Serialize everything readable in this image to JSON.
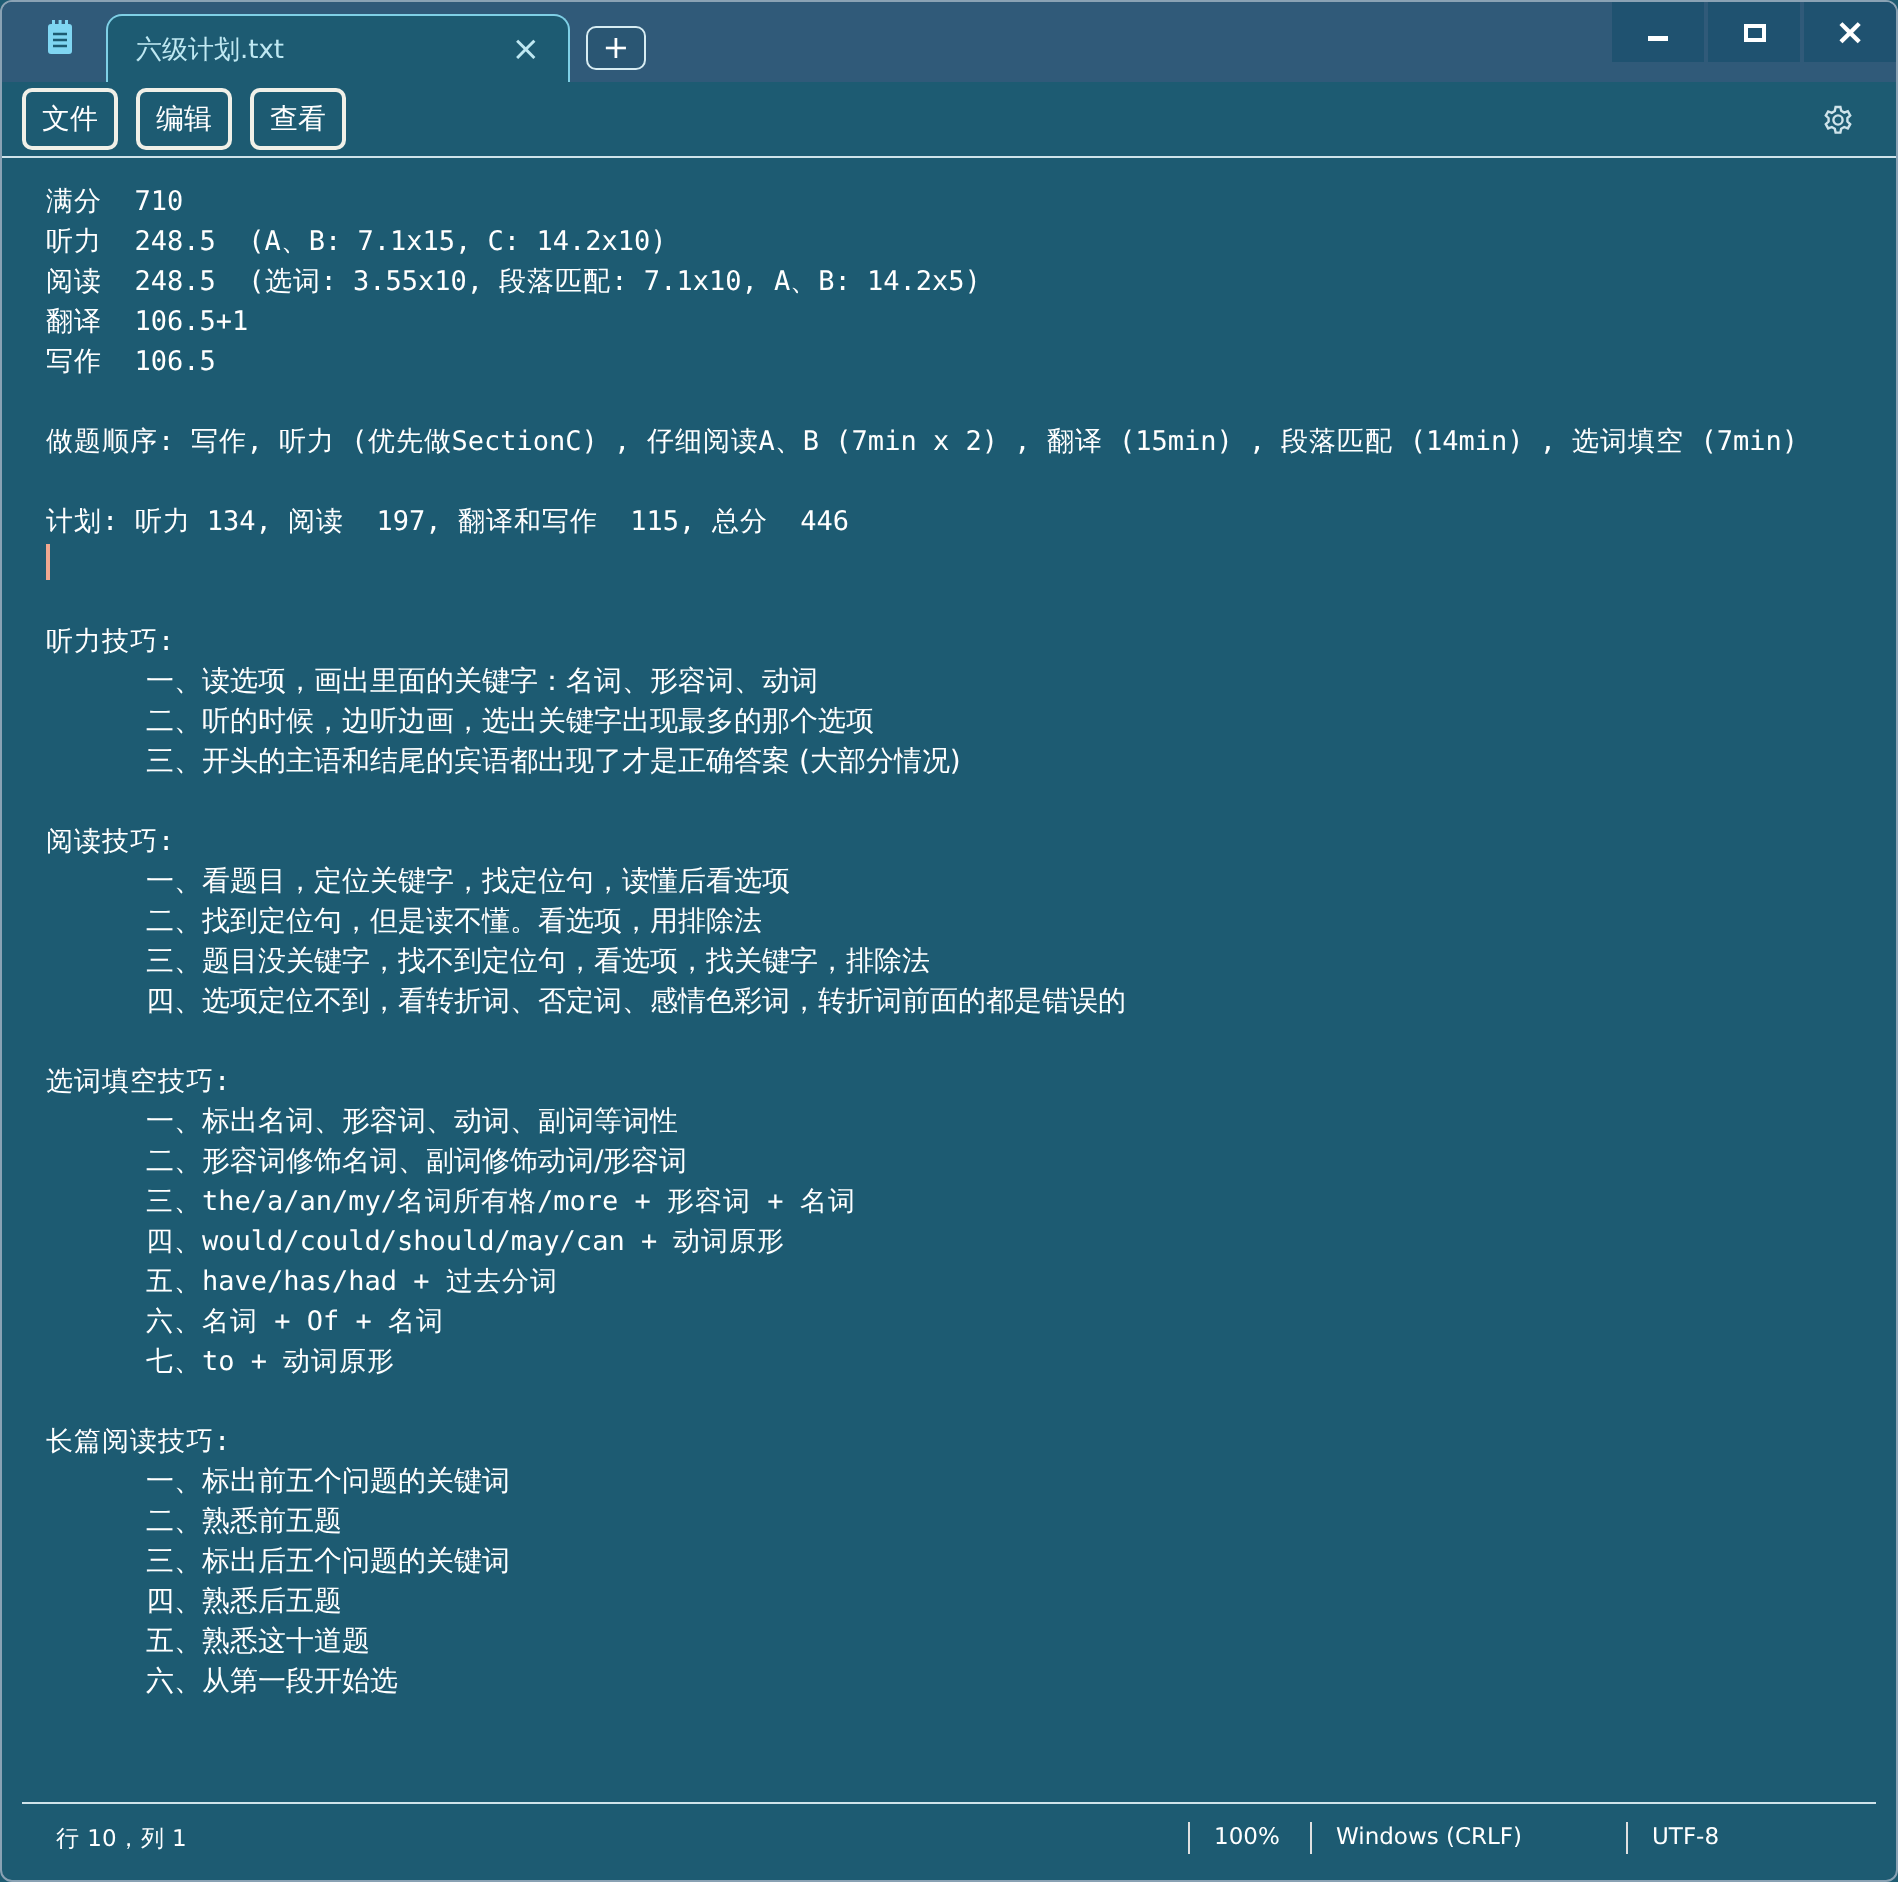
{
  "tab": {
    "title": "六级计划.txt",
    "close": "×",
    "new_tab": "+"
  },
  "window_controls": {
    "close": "×"
  },
  "menu": [
    "文件",
    "编辑",
    "查看"
  ],
  "lines": [
    {
      "kind": "text",
      "text": "满分  710"
    },
    {
      "kind": "text",
      "text": "听力  248.5  (A、B: 7.1x15, C: 14.2x10)"
    },
    {
      "kind": "text",
      "text": "阅读  248.5  (选词: 3.55x10, 段落匹配: 7.1x10, A、B: 14.2x5)"
    },
    {
      "kind": "text",
      "text": "翻译  106.5+1"
    },
    {
      "kind": "text",
      "text": "写作  106.5"
    },
    {
      "kind": "blank"
    },
    {
      "kind": "text",
      "text": "做题顺序: 写作, 听力 (优先做SectionC) , 仔细阅读A、B (7min x 2) , 翻译 (15min) , 段落匹配 (14min) , 选词填空 (7min)"
    },
    {
      "kind": "blank"
    },
    {
      "kind": "text",
      "text": "计划: 听力 134, 阅读  197, 翻译和写作  115, 总分  446"
    },
    {
      "kind": "caret"
    },
    {
      "kind": "blank"
    },
    {
      "kind": "text",
      "text": "听力技巧:"
    },
    {
      "kind": "indented",
      "text": "一、读选项，画出里面的关键字：名词、形容词、动词"
    },
    {
      "kind": "indented",
      "text": "二、听的时候，边听边画，选出关键字出现最多的那个选项"
    },
    {
      "kind": "indented",
      "text": "三、开头的主语和结尾的宾语都出现了才是正确答案 (大部分情况)"
    },
    {
      "kind": "blank"
    },
    {
      "kind": "text",
      "text": "阅读技巧:"
    },
    {
      "kind": "indented",
      "text": "一、看题目，定位关键字，找定位句，读懂后看选项"
    },
    {
      "kind": "indented",
      "text": "二、找到定位句，但是读不懂。看选项，用排除法"
    },
    {
      "kind": "indented",
      "text": "三、题目没关键字，找不到定位句，看选项，找关键字，排除法"
    },
    {
      "kind": "indented",
      "text": "四、选项定位不到，看转折词、否定词、感情色彩词，转折词前面的都是错误的"
    },
    {
      "kind": "blank"
    },
    {
      "kind": "text",
      "text": "选词填空技巧:"
    },
    {
      "kind": "indented",
      "text": "一、标出名词、形容词、动词、副词等词性"
    },
    {
      "kind": "indented",
      "text": "二、形容词修饰名词、副词修饰动词/形容词"
    },
    {
      "kind": "indented",
      "text": "三、the/a/an/my/名词所有格/more + 形容词 + 名词"
    },
    {
      "kind": "indented",
      "text": "四、would/could/should/may/can + 动词原形"
    },
    {
      "kind": "indented",
      "text": "五、have/has/had + 过去分词"
    },
    {
      "kind": "indented",
      "text": "六、名词 + Of + 名词"
    },
    {
      "kind": "indented",
      "text": "七、to + 动词原形"
    },
    {
      "kind": "blank"
    },
    {
      "kind": "text",
      "text": "长篇阅读技巧:"
    },
    {
      "kind": "indented",
      "text": "一、标出前五个问题的关键词"
    },
    {
      "kind": "indented",
      "text": "二、熟悉前五题"
    },
    {
      "kind": "indented",
      "text": "三、标出后五个问题的关键词"
    },
    {
      "kind": "indented",
      "text": "四、熟悉后五题"
    },
    {
      "kind": "indented",
      "text": "五、熟悉这十道题"
    },
    {
      "kind": "indented",
      "text": "六、从第一段开始选"
    }
  ],
  "status_bar": {
    "position": "行 10，列 1",
    "zoom": "100%",
    "line_ending": "Windows (CRLF)",
    "encoding": "UTF-8"
  }
}
